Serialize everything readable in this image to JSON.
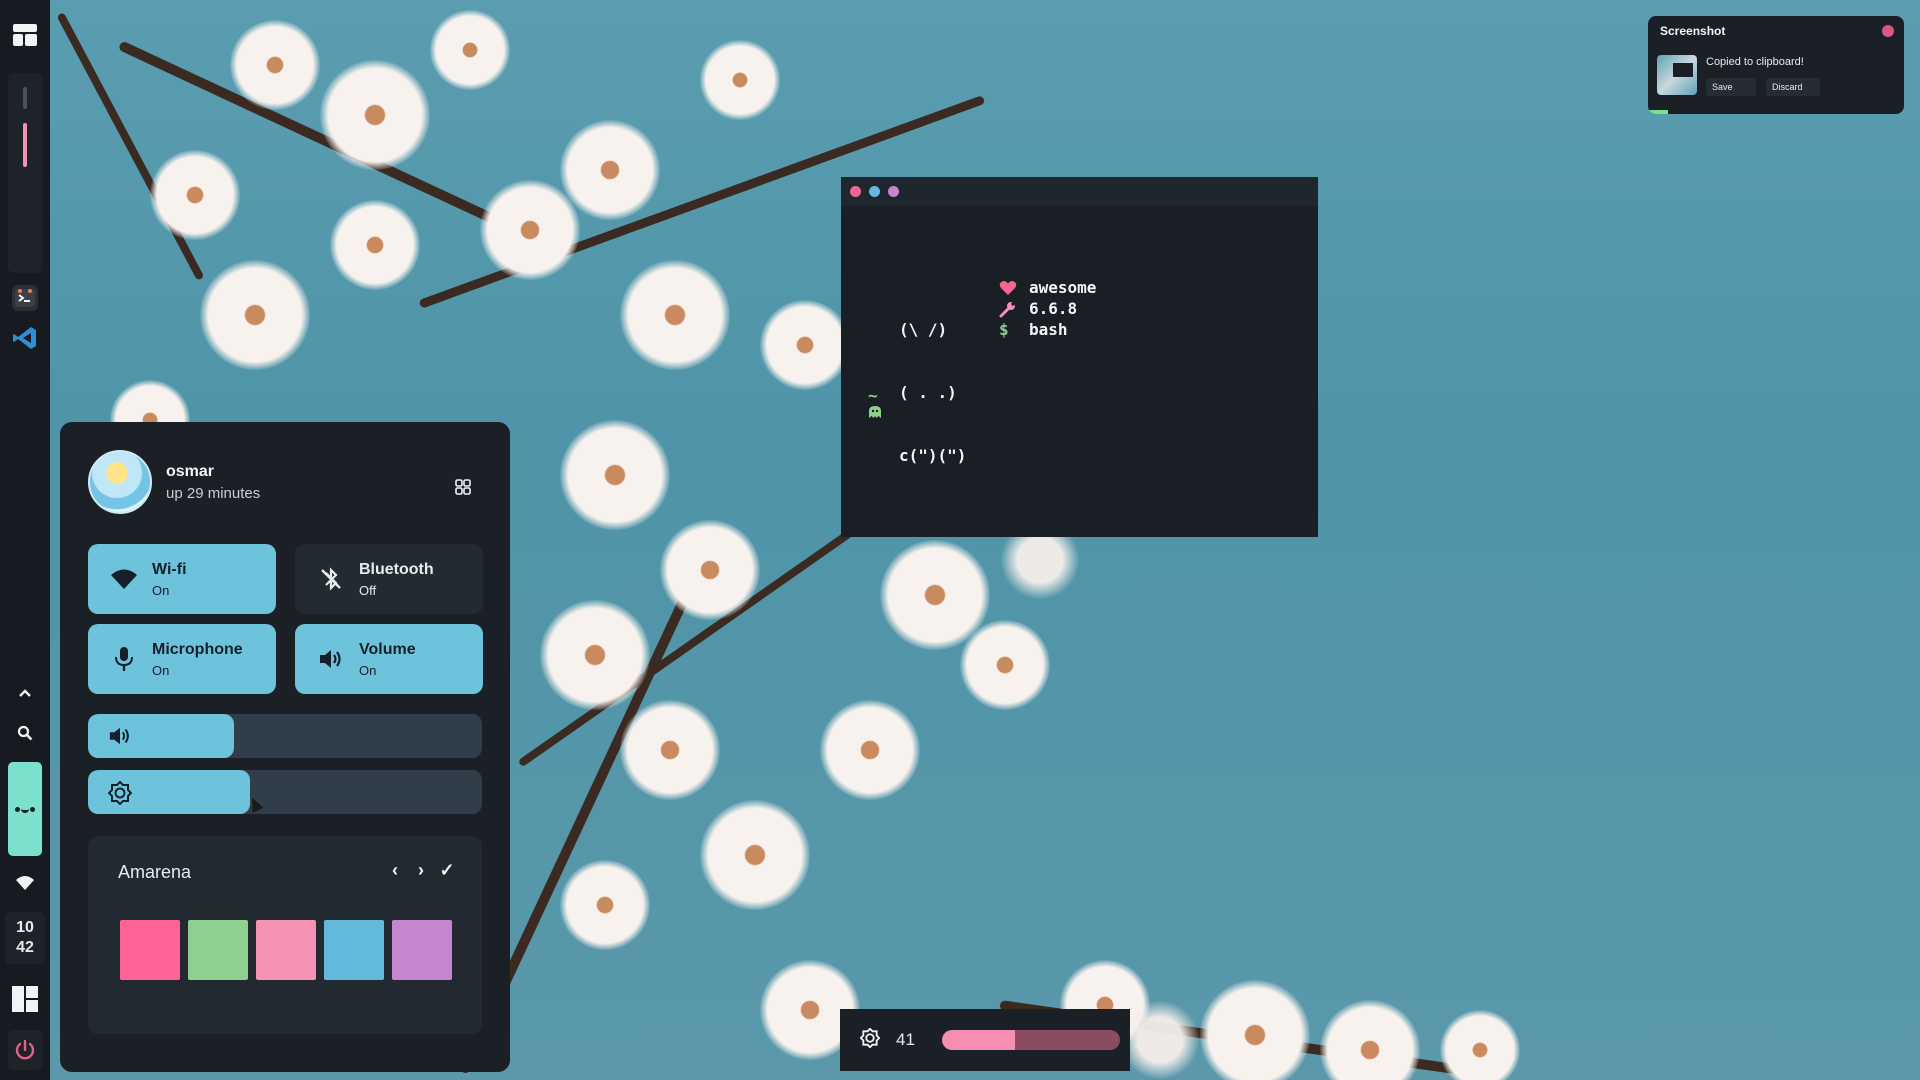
{
  "colors": {
    "accent_blue": "#6ec3dc",
    "accent_pink": "#f58fb2",
    "panel_bg": "#1b2027",
    "sidebar_bg": "#171b21",
    "ghost_mint": "#7be0cc"
  },
  "sidebar": {
    "top_icon": "layout-icon",
    "apps": [
      "terminal-icon",
      "vscode-icon"
    ],
    "clock_hour": "10",
    "clock_minute": "42",
    "tray": [
      "chevron-up-icon",
      "search-icon",
      "ghost-icon",
      "wifi-icon"
    ],
    "bottom": [
      "layout-icon",
      "power-icon"
    ]
  },
  "control_center": {
    "username": "osmar",
    "uptime": "up 29 minutes",
    "toggles": [
      {
        "name": "Wi-fi",
        "state": "On",
        "icon": "wifi-icon",
        "active": true
      },
      {
        "name": "Bluetooth",
        "state": "Off",
        "icon": "bluetooth-off-icon",
        "active": false
      },
      {
        "name": "Microphone",
        "state": "On",
        "icon": "microphone-icon",
        "active": true
      },
      {
        "name": "Volume",
        "state": "On",
        "icon": "volume-icon",
        "active": true
      }
    ],
    "volume_level": 0.37,
    "brightness_level": 0.41,
    "theme": {
      "name": "Amarena",
      "swatches": [
        "#ff6397",
        "#8fd08e",
        "#f592b3",
        "#63b9da",
        "#c585cf"
      ]
    }
  },
  "terminal": {
    "dots": [
      "#f2678f",
      "#63b9da",
      "#c585cf"
    ],
    "art": [
      "(\\ /)",
      "( . .)",
      "c(\")(\")"
    ],
    "info": [
      {
        "icon": "heart-icon",
        "color": "#f2678f",
        "text": "awesome"
      },
      {
        "icon": "wrench-icon",
        "color": "#f592b3",
        "text": "6.6.8"
      },
      {
        "icon": "dollar-icon",
        "color": "#8fd08e",
        "text": "bash"
      }
    ],
    "prompt_dir": "~"
  },
  "notification": {
    "title": "Screenshot",
    "message": "Copied to clipboard!",
    "save_label": "Save",
    "discard_label": "Discard"
  },
  "osd": {
    "icon": "brightness-icon",
    "value": "41",
    "level": 0.41
  }
}
